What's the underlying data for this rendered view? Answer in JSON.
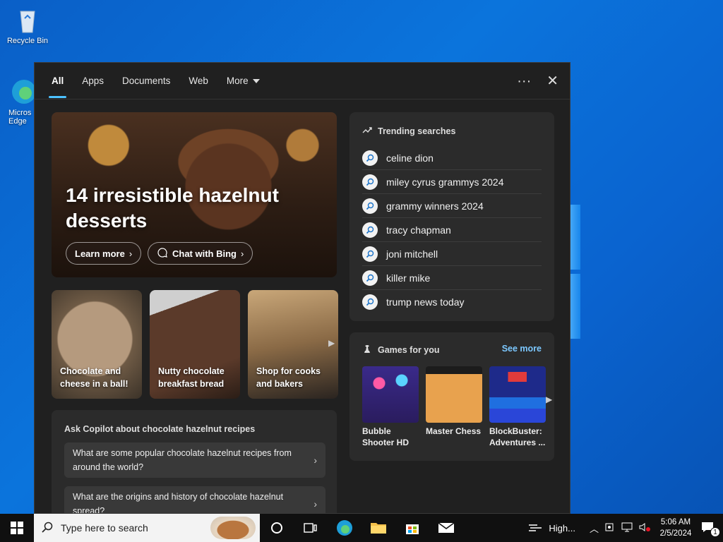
{
  "desktop": {
    "recycle_bin_label": "Recycle Bin",
    "edge_label": "Micros Edge"
  },
  "search_flyout": {
    "tabs": [
      {
        "label": "All",
        "active": true
      },
      {
        "label": "Apps"
      },
      {
        "label": "Documents"
      },
      {
        "label": "Web"
      },
      {
        "label": "More"
      }
    ],
    "more_options": "···",
    "close": "✕",
    "hero": {
      "title": "14 irresistible hazelnut desserts",
      "learn_more": "Learn more",
      "chat_with_bing": "Chat with Bing"
    },
    "cards": [
      {
        "label": "Chocolate and cheese in a ball!"
      },
      {
        "label": "Nutty chocolate breakfast bread"
      },
      {
        "label": "Shop for cooks and bakers"
      }
    ],
    "trending": {
      "title": "Trending searches",
      "items": [
        "celine dion",
        "miley cyrus grammys 2024",
        "grammy winners 2024",
        "tracy chapman",
        "joni mitchell",
        "killer mike",
        "trump news today"
      ]
    },
    "games": {
      "title": "Games for you",
      "see_more": "See more",
      "items": [
        {
          "name": "Bubble Shooter HD"
        },
        {
          "name": "Master Chess"
        },
        {
          "name": "BlockBuster: Adventures ..."
        }
      ]
    },
    "copilot": {
      "title": "Ask Copilot about chocolate hazelnut recipes",
      "questions": [
        "What are some popular chocolate hazelnut recipes from around the world?",
        "What are the origins and history of chocolate hazelnut spread?"
      ]
    }
  },
  "taskbar": {
    "search_placeholder": "Type here to search",
    "weather_label": "High...",
    "time": "5:06 AM",
    "date": "2/5/2024",
    "notification_count": "1"
  },
  "colors": {
    "accent": "#4cc2ff",
    "panel_bg": "#202020",
    "card_bg": "#2b2b2b",
    "link": "#7cc8ff"
  }
}
